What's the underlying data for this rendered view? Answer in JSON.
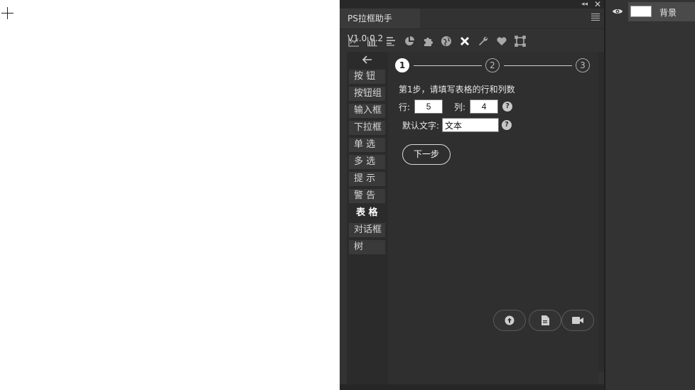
{
  "panel": {
    "title": "PS拉框助手V1.0.0.2",
    "toolbar_icons": [
      "line-chart-icon",
      "bar-chart-icon",
      "align-left-icon",
      "pie-chart-icon",
      "puzzle-icon",
      "globe-icon",
      "tools-cross-icon",
      "wrench-icon",
      "heart-icon",
      "frame-icon"
    ],
    "active_tool": "tools-cross-icon"
  },
  "sidebar": {
    "items": [
      {
        "label": "按 钮"
      },
      {
        "label": "按钮组"
      },
      {
        "label": "输入框"
      },
      {
        "label": "下拉框"
      },
      {
        "label": "单 选"
      },
      {
        "label": "多 选"
      },
      {
        "label": "提 示"
      },
      {
        "label": "警 告"
      },
      {
        "label": "表 格"
      },
      {
        "label": "对话框"
      },
      {
        "label": "树"
      }
    ],
    "active_index": 8
  },
  "wizard": {
    "steps": [
      "1",
      "2",
      "3"
    ],
    "current_step": 1,
    "instruction": "第1步，请填写表格的行和列数",
    "rows_label": "行:",
    "rows_value": "5",
    "cols_label": "列:",
    "cols_value": "4",
    "default_text_label": "默认文字:",
    "default_text_value": "文本",
    "help_glyph": "?",
    "next_label": "下一步"
  },
  "layers": {
    "layer_name": "背景"
  },
  "colors": {
    "panel_bg": "#323232",
    "accent_white": "#ffffff",
    "sidebar_bg": "#2b2b2b"
  }
}
